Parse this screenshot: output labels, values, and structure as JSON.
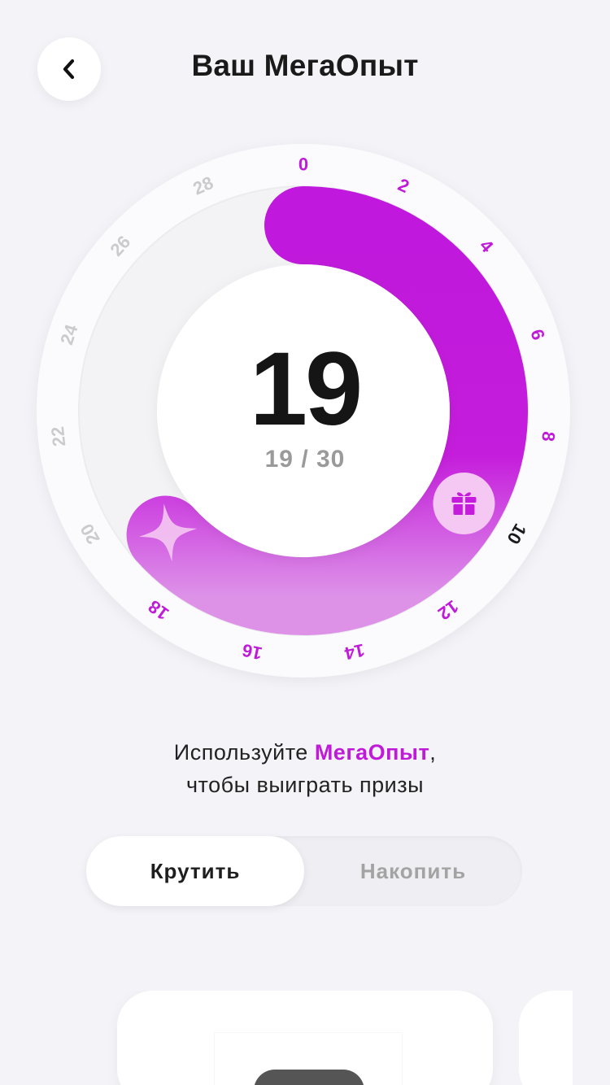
{
  "header": {
    "title": "Ваш МегаОпыт",
    "back_icon": "chevron-left-icon"
  },
  "progress": {
    "value": 19,
    "max": 30,
    "label": "19 / 30",
    "gift_marker": 10,
    "ticks": [
      "0",
      "2",
      "4",
      "6",
      "8",
      "10",
      "12",
      "14",
      "16",
      "18",
      "20",
      "22",
      "24",
      "26",
      "28"
    ],
    "colors": {
      "accent": "#c01ad9",
      "accent_light": "#dd8ee8",
      "tick_active": "#c01ad9",
      "tick_milestone": "#1a1a1a",
      "tick_inactive": "#cbcbcb"
    },
    "icons": [
      "gift-icon",
      "sparkle-icon"
    ]
  },
  "info": {
    "line1_prefix": "Используйте ",
    "line1_accent": "МегаОпыт",
    "line1_suffix": ",",
    "line2": "чтобы выиграть призы"
  },
  "tabs": {
    "spin": "Крутить",
    "save": "Накопить",
    "selected": "spin"
  }
}
